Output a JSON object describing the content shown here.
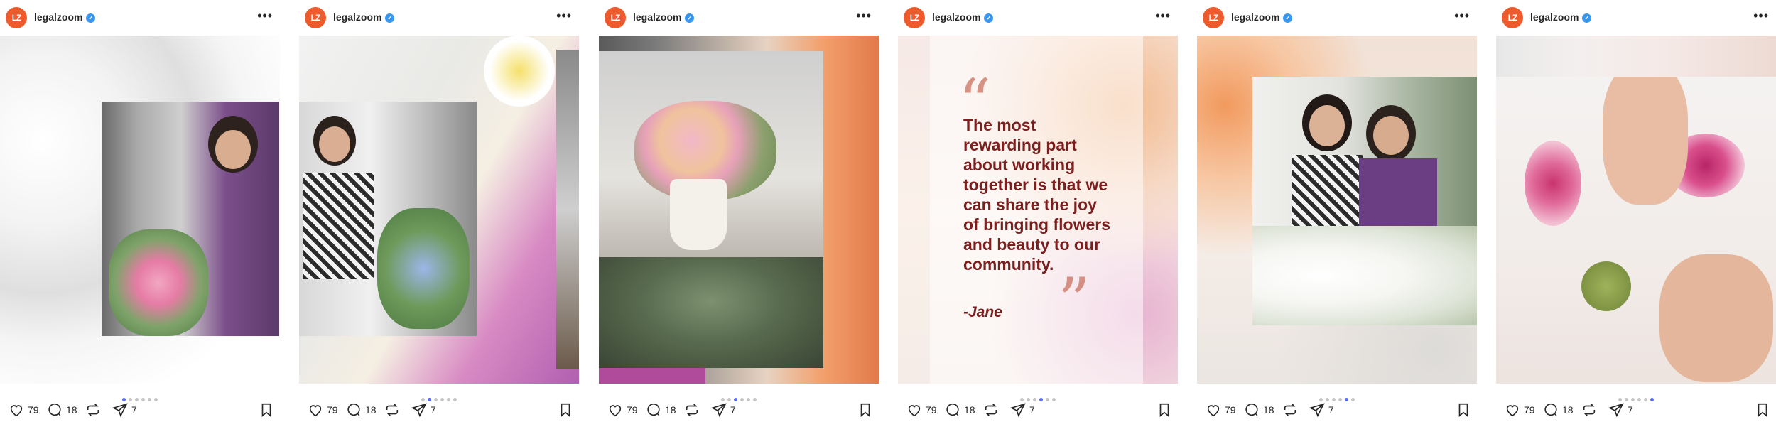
{
  "account": {
    "username": "legalzoom",
    "avatar_text": "LZ",
    "brand_color": "#ee5a2c",
    "verified_color": "#3897f0"
  },
  "icons": [
    "heart-icon",
    "comment-icon",
    "repost-icon",
    "share-icon",
    "bookmark-icon",
    "more-icon",
    "verified-icon"
  ],
  "quote": {
    "text": "The most rewarding part about working together is that we can share the joy of bringing flowers and beauty to our community.",
    "author": "-Jane"
  },
  "carousel_slides_total": 6,
  "posts": [
    {
      "likes": "79",
      "comments": "18",
      "reposts": "",
      "shares": "7",
      "active_slide": 1
    },
    {
      "likes": "79",
      "comments": "18",
      "reposts": "",
      "shares": "7",
      "active_slide": 2
    },
    {
      "likes": "79",
      "comments": "18",
      "reposts": "",
      "shares": "7",
      "active_slide": 3
    },
    {
      "likes": "79",
      "comments": "18",
      "reposts": "",
      "shares": "7",
      "active_slide": 4
    },
    {
      "likes": "79",
      "comments": "18",
      "reposts": "",
      "shares": "7",
      "active_slide": 5
    },
    {
      "likes": "79",
      "comments": "18",
      "reposts": "",
      "shares": "7",
      "active_slide": 6
    }
  ]
}
